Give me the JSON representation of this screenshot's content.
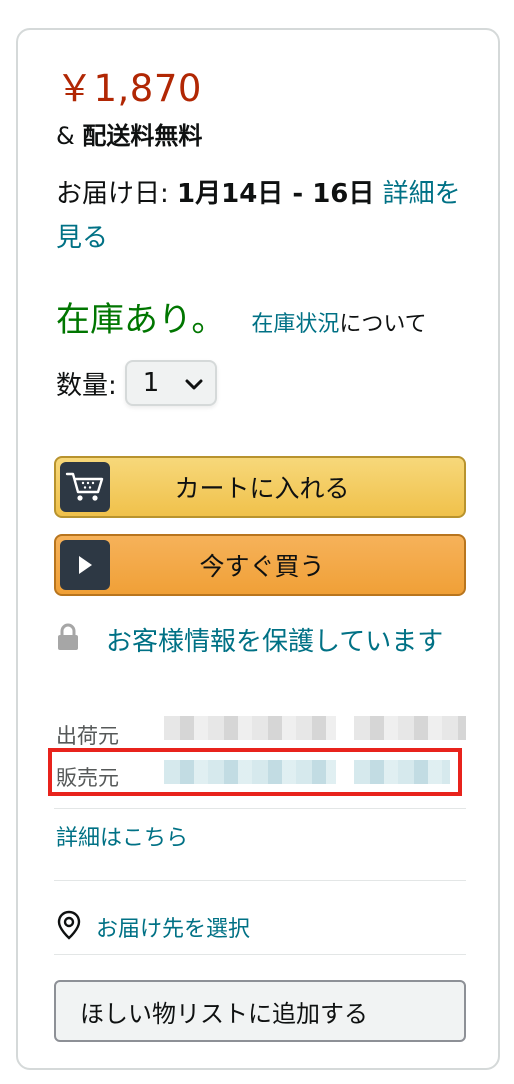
{
  "price": "￥1,870",
  "shipping": {
    "prefix": "& ",
    "label": "配送料無料"
  },
  "delivery": {
    "label": "お届け日: ",
    "date": "1月14日 - 16日",
    "link": "詳細を見る"
  },
  "stock": {
    "status": "在庫あり。",
    "link": "在庫状況",
    "suffix": "について"
  },
  "quantity": {
    "label": "数量:",
    "value": "1"
  },
  "buttons": {
    "add_to_cart": "カートに入れる",
    "buy_now": "今すぐ買う"
  },
  "secure": {
    "text": "お客様情報を保護しています"
  },
  "seller_info": {
    "ships_from_label": "出荷元",
    "sold_by_label": "販売元"
  },
  "details_link": "詳細はこちら",
  "address_link": "お届け先を選択",
  "wishlist_button": "ほしい物リストに追加する",
  "colors": {
    "price": "#b12704",
    "stock": "#007600",
    "link": "#007185",
    "cart_button": "#f0c14b",
    "buy_button": "#f0a037",
    "highlight": "#e8231c"
  }
}
